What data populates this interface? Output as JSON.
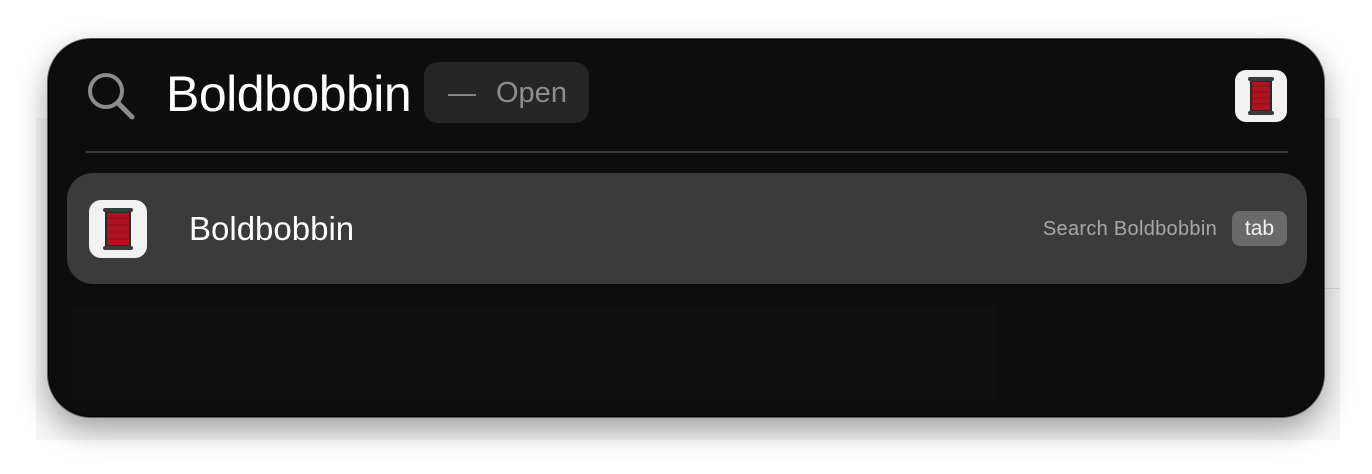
{
  "search": {
    "query": "Boldbobbin",
    "hint_dash": "—",
    "hint_label": "Open"
  },
  "header": {
    "app_icon": "spool-icon"
  },
  "results": [
    {
      "title": "Boldbobbin",
      "icon": "spool-icon",
      "action_label": "Search Boldbobbin",
      "shortcut_key": "tab"
    }
  ],
  "colors": {
    "panel_background": "#0d0d0d",
    "selected_row": "#3b3b3b",
    "spool_red": "#b0131f",
    "key_badge": "#6a6a6a"
  }
}
